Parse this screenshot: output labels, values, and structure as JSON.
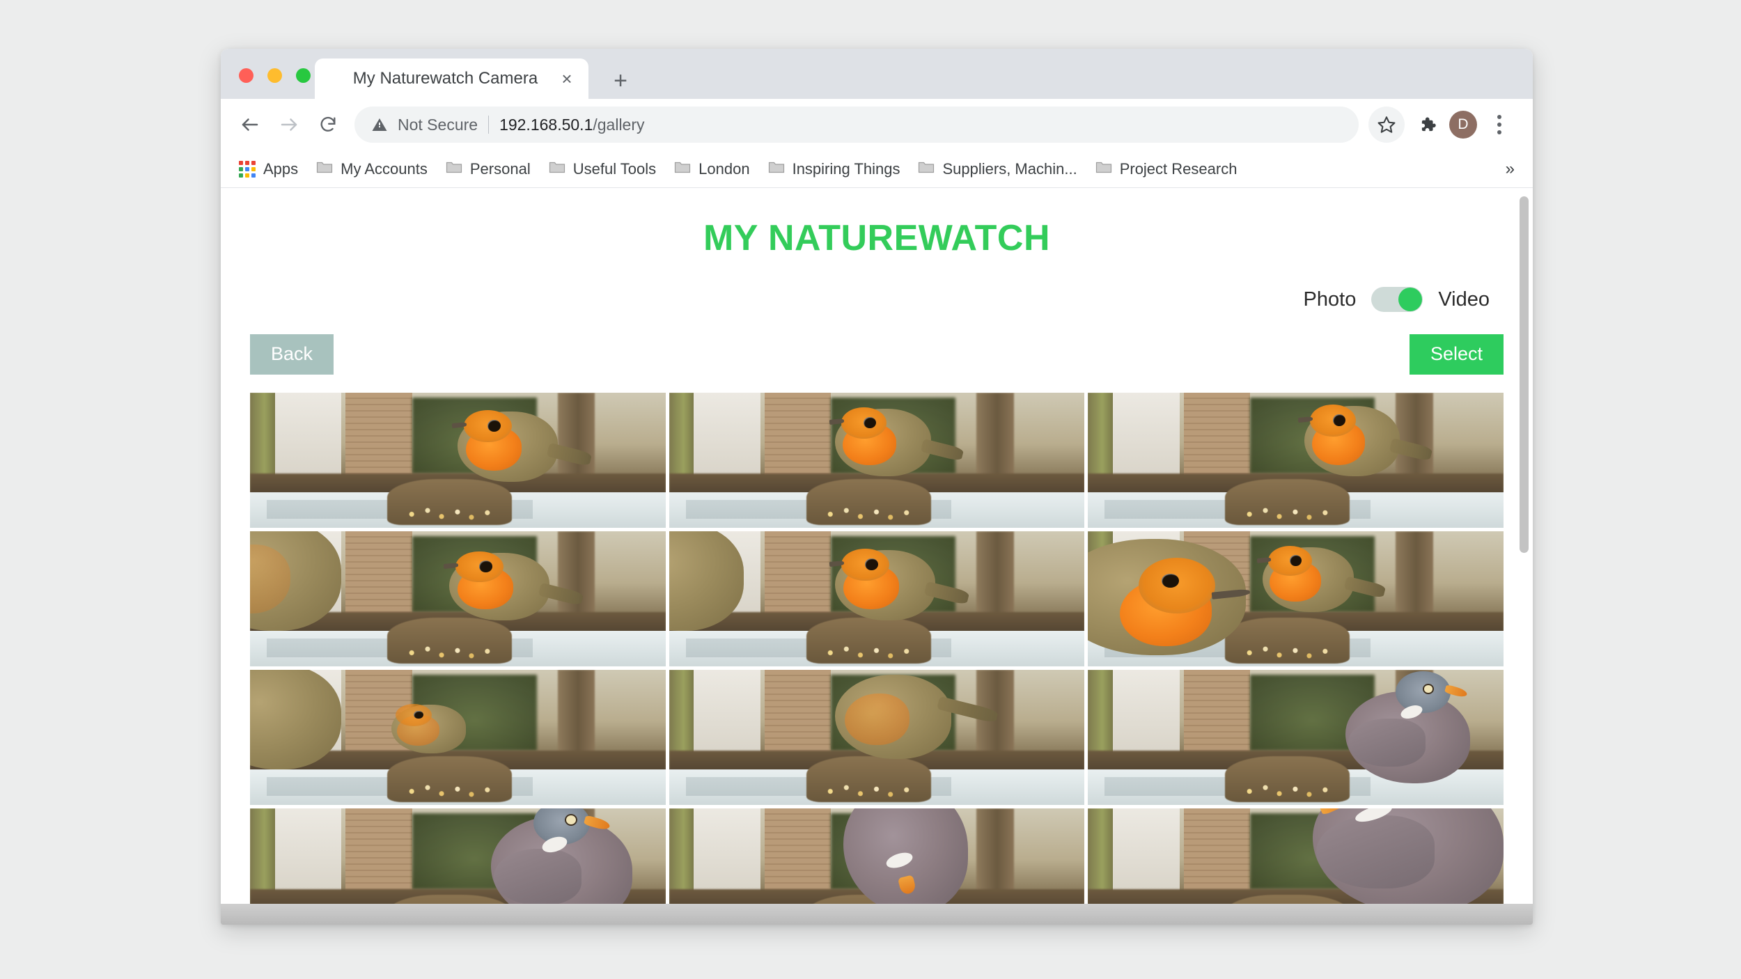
{
  "browser": {
    "tab": {
      "title": "My Naturewatch Camera",
      "close_label": "×"
    },
    "new_tab_label": "+",
    "omnibox": {
      "security_label": "Not Secure",
      "url_host": "192.168.50.1",
      "url_path": "/gallery"
    },
    "avatar_initial": "D",
    "bookmarks": [
      {
        "label": "Apps",
        "icon": "apps-grid-icon"
      },
      {
        "label": "My Accounts",
        "icon": "folder-icon"
      },
      {
        "label": "Personal",
        "icon": "folder-icon"
      },
      {
        "label": "Useful Tools",
        "icon": "folder-icon"
      },
      {
        "label": "London",
        "icon": "folder-icon"
      },
      {
        "label": "Inspiring Things",
        "icon": "folder-icon"
      },
      {
        "label": "Suppliers, Machin...",
        "icon": "folder-icon"
      },
      {
        "label": "Project Research",
        "icon": "folder-icon"
      }
    ],
    "bookmarks_overflow_label": "»"
  },
  "page": {
    "title": "MY NATUREWATCH",
    "toggle": {
      "left_label": "Photo",
      "right_label": "Video",
      "state": "right",
      "track_color": "#cfdbd8",
      "knob_color": "#2ecc5e"
    },
    "buttons": {
      "back_label": "Back",
      "back_color": "#a8c2be",
      "select_label": "Select",
      "select_color": "#2ecc5e"
    },
    "accent_color": "#33cc5a",
    "gallery": {
      "columns": 3,
      "items": [
        {
          "subject": "robin",
          "variant": "robin-right-perched"
        },
        {
          "subject": "robin",
          "variant": "robin-center-perched"
        },
        {
          "subject": "robin",
          "variant": "robin-right-tail"
        },
        {
          "subject": "robin",
          "variant": "two-robins-left"
        },
        {
          "subject": "robin",
          "variant": "robin-center-facing"
        },
        {
          "subject": "robin",
          "variant": "two-robins-close"
        },
        {
          "subject": "robin",
          "variant": "robin-pair-ground"
        },
        {
          "subject": "robin",
          "variant": "robin-wings-open"
        },
        {
          "subject": "pigeon",
          "variant": "pigeon-right-perched"
        },
        {
          "subject": "pigeon",
          "variant": "pigeon-head-right"
        },
        {
          "subject": "pigeon",
          "variant": "pigeon-feeding"
        },
        {
          "subject": "pigeon",
          "variant": "pigeon-large-right"
        }
      ]
    }
  }
}
